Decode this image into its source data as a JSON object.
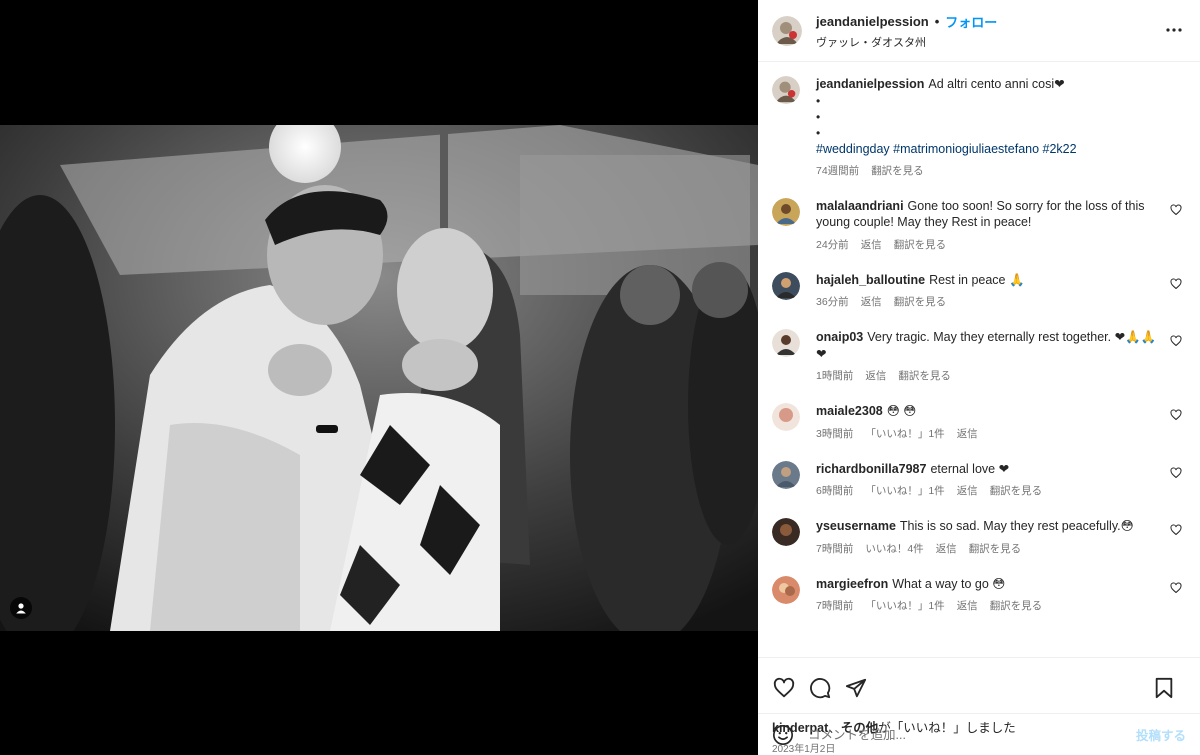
{
  "post": {
    "username": "jeandanielpession",
    "separator": "•",
    "follow_label": "フォロー",
    "location": "ヴァッレ・ダオスタ州"
  },
  "caption": {
    "username": "jeandanielpession",
    "text": "Ad altri cento anni cosi❤",
    "dot1": "•",
    "dot2": "•",
    "dot3": "•",
    "hashtags": "#weddingday #matrimoniogiuliaestefano #2k22",
    "time": "74週間前",
    "translate": "翻訳を見る"
  },
  "comments": [
    {
      "username": "malalaandriani",
      "text": "Gone too soon! So sorry for the loss of this young couple! May they Rest in peace!",
      "time": "24分前",
      "likes": "",
      "reply": "返信",
      "translate": "翻訳を見る"
    },
    {
      "username": "hajaleh_balloutine",
      "text": "Rest in peace 🙏",
      "time": "36分前",
      "likes": "",
      "reply": "返信",
      "translate": "翻訳を見る"
    },
    {
      "username": "onaip03",
      "text": "Very tragic. May they eternally rest together. ❤🙏🙏❤",
      "time": "1時間前",
      "likes": "",
      "reply": "返信",
      "translate": "翻訳を見る"
    },
    {
      "username": "maiale2308",
      "text": "😳 😳",
      "time": "3時間前",
      "likes": "「いいね！」1件",
      "reply": "返信",
      "translate": ""
    },
    {
      "username": "richardbonilla7987",
      "text": "eternal love ❤",
      "time": "6時間前",
      "likes": "「いいね！」1件",
      "reply": "返信",
      "translate": "翻訳を見る"
    },
    {
      "username": "yseusername",
      "text": "This is so sad. May they rest peacefully.😳",
      "time": "7時間前",
      "likes": "いいね！4件",
      "reply": "返信",
      "translate": "翻訳を見る"
    },
    {
      "username": "margieefron",
      "text": "What a way to go 😳",
      "time": "7時間前",
      "likes": "「いいね！」1件",
      "reply": "返信",
      "translate": "翻訳を見る"
    }
  ],
  "likes": {
    "user": "kinderpat",
    "sep": "、",
    "others": "その他",
    "suffix": "が「いいね！」しました"
  },
  "date": "2023年1月2日",
  "add_comment": {
    "placeholder": "コメントを追加...",
    "post_label": "投稿する"
  },
  "colors": {
    "link": "#0095f6",
    "hashtag": "#00376b",
    "muted": "#737373",
    "post_disabled": "#b2dffc"
  }
}
